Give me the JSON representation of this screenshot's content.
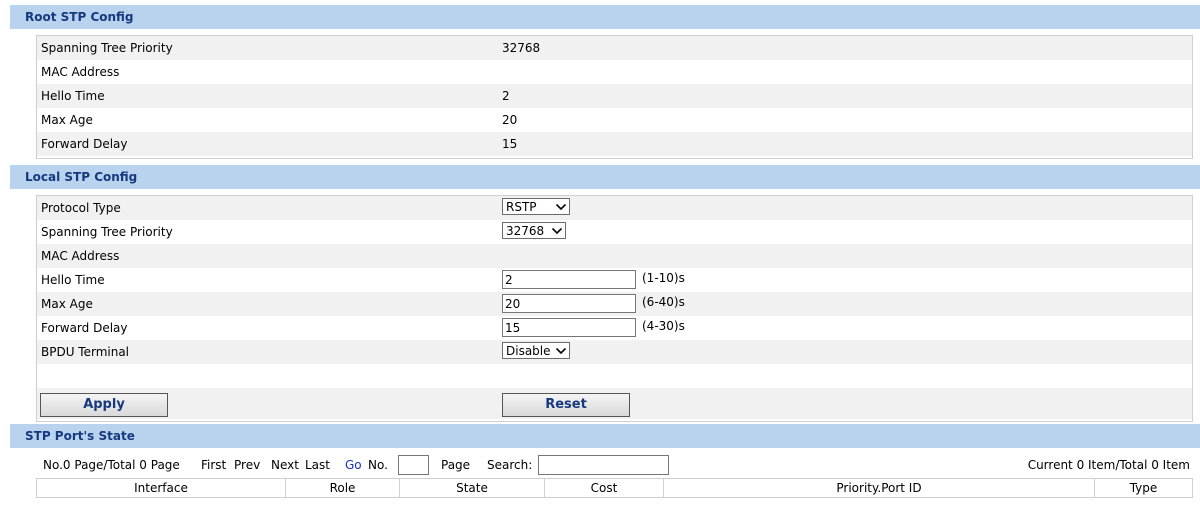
{
  "root_stp": {
    "title": "Root STP Config",
    "rows": [
      {
        "label": "Spanning Tree Priority",
        "value": "32768"
      },
      {
        "label": "MAC Address",
        "value": ""
      },
      {
        "label": "Hello Time",
        "value": "2"
      },
      {
        "label": "Max Age",
        "value": "20"
      },
      {
        "label": "Forward Delay",
        "value": "15"
      }
    ]
  },
  "local_stp": {
    "title": "Local STP Config",
    "protocol_type": {
      "label": "Protocol Type",
      "value": "RSTP"
    },
    "priority": {
      "label": "Spanning Tree Priority",
      "value": "32768"
    },
    "mac_address": {
      "label": "MAC Address",
      "value": ""
    },
    "hello_time": {
      "label": "Hello Time",
      "value": "2",
      "range": "(1-10)s"
    },
    "max_age": {
      "label": "Max Age",
      "value": "20",
      "range": "(6-40)s"
    },
    "forward_delay": {
      "label": "Forward Delay",
      "value": "15",
      "range": "(4-30)s"
    },
    "bpdu_terminal": {
      "label": "BPDU Terminal",
      "value": "Disable"
    },
    "apply_label": "Apply",
    "reset_label": "Reset"
  },
  "port_state": {
    "title": "STP Port's State",
    "pager": {
      "page_info": "No.0 Page/Total 0 Page",
      "first": "First",
      "prev": "Prev",
      "next": "Next",
      "last": "Last",
      "go": "Go",
      "no_label": "No.",
      "page_label": "Page",
      "search_label": "Search:",
      "page_value": "",
      "search_value": "",
      "item_info": "Current 0 Item/Total 0 Item"
    },
    "columns": [
      "Interface",
      "Role",
      "State",
      "Cost",
      "Priority.Port ID",
      "Type"
    ]
  }
}
